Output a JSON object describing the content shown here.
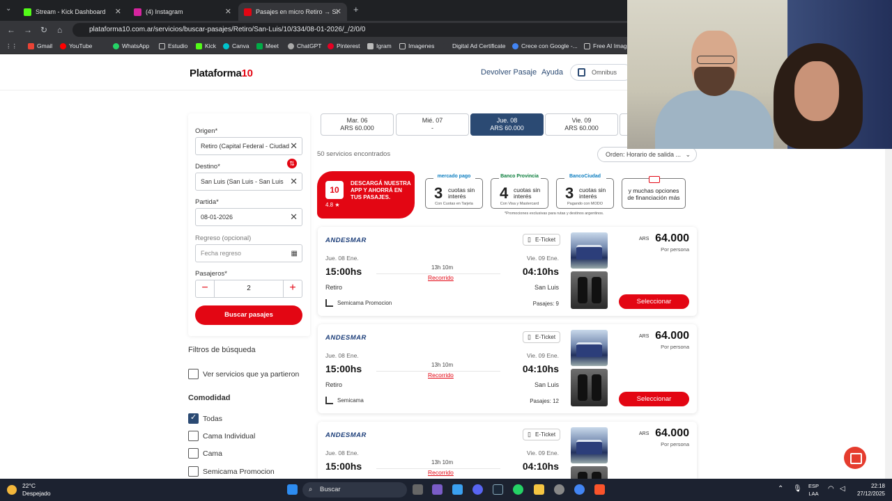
{
  "browser": {
    "tabs": [
      {
        "title": "Stream - Kick Dashboard",
        "color": "#53fc18"
      },
      {
        "title": "(4) Instagram",
        "color": "#d6249f"
      },
      {
        "title": "Pasajes en micro Retiro → San L",
        "color": "#e30613"
      }
    ],
    "url": "plataforma10.com.ar/servicios/buscar-pasajes/Retiro/San-Luis/10/334/08-01-2026/_/2/0/0",
    "bookmarks": [
      "Gmail",
      "YouTube",
      "WhatsApp",
      "Estudio",
      "Kick",
      "Canva",
      "Meet",
      "ChatGPT",
      "Pinterest",
      "Igram",
      "Imagenes",
      "Digital Ad Certificate",
      "Crece con Google -...",
      "Free AI Image"
    ]
  },
  "site": {
    "logo_main": "Plataforma",
    "logo_num": "10",
    "nav": {
      "devolver": "Devolver Pasaje",
      "ayuda": "Ayuda",
      "omnibus": "Omnibus"
    }
  },
  "search": {
    "origen_label": "Origen*",
    "origen_value": "Retiro (Capital Federal - Ciudad",
    "destino_label": "Destino*",
    "destino_value": "San Luis (San Luis - San Luis",
    "partida_label": "Partida*",
    "partida_value": "08-01-2026",
    "regreso_label": "Regreso (opcional)",
    "regreso_placeholder": "Fecha regreso",
    "pasajeros_label": "Pasajeros*",
    "pasajeros_value": "2",
    "buscar": "Buscar pasajes"
  },
  "filters": {
    "title": "Filtros de búsqueda",
    "ver_partidos": "Ver servicios que ya partieron",
    "comodidad_title": "Comodidad",
    "options": [
      {
        "label": "Todas",
        "checked": true
      },
      {
        "label": "Cama Individual",
        "checked": false
      },
      {
        "label": "Cama",
        "checked": false
      },
      {
        "label": "Semicama Promocion",
        "checked": false
      }
    ]
  },
  "dates": [
    {
      "day": "Mar. 06",
      "price": "ARS 60.000",
      "selected": false
    },
    {
      "day": "Mié. 07",
      "price": "-",
      "selected": false
    },
    {
      "day": "Jue. 08",
      "price": "ARS 60.000",
      "selected": true
    },
    {
      "day": "Vie. 09",
      "price": "ARS 60.000",
      "selected": false
    }
  ],
  "results": {
    "count": "50 servicios encontrados",
    "order": "Orden: Horario de salida ..."
  },
  "promo": {
    "app_text": "DESCARGÁ NUESTRA APP Y AHORRÁ EN TUS PASAJES.",
    "app_rating": "4.8 ★",
    "cards": [
      {
        "brand": "mercado pago",
        "num": "3",
        "text": "cuotas sin interés",
        "foot": "Con Cuotas en Tarjeta"
      },
      {
        "brand": "Banco Provincia",
        "num": "4",
        "text": "cuotas sin interés",
        "foot": "Con Visa y Mastercard"
      },
      {
        "brand": "BancoCiudad",
        "num": "3",
        "text": "cuotas sin interés",
        "foot": "Pagando con MODO"
      },
      {
        "brand": "",
        "num": "",
        "text": "y muchas opciones de financiación más",
        "foot": ""
      }
    ],
    "note": "*Promociones exclusivas para rutas y destinos argentinos."
  },
  "trips": [
    {
      "company": "ANDESMAR",
      "eticket": "E-Ticket",
      "ddate": "Jue. 08 Ene.",
      "adate": "Vie. 09 Ene.",
      "dtime": "15:00hs",
      "atime": "04:10hs",
      "duration": "13h 10m",
      "route": "Recorrido",
      "dcity": "Retiro",
      "acity": "San Luis",
      "seat": "Semicama Promocion",
      "pasajes": "Pasajes: 9",
      "currency": "ARS",
      "price": "64.000",
      "per": "Por persona",
      "select": "Seleccionar"
    },
    {
      "company": "ANDESMAR",
      "eticket": "E-Ticket",
      "ddate": "Jue. 08 Ene.",
      "adate": "Vie. 09 Ene.",
      "dtime": "15:00hs",
      "atime": "04:10hs",
      "duration": "13h 10m",
      "route": "Recorrido",
      "dcity": "Retiro",
      "acity": "San Luis",
      "seat": "Semicama",
      "pasajes": "Pasajes: 12",
      "currency": "ARS",
      "price": "64.000",
      "per": "Por persona",
      "select": "Seleccionar"
    },
    {
      "company": "ANDESMAR",
      "eticket": "E-Ticket",
      "ddate": "Jue. 08 Ene.",
      "adate": "Vie. 09 Ene.",
      "dtime": "15:00hs",
      "atime": "04:10hs",
      "duration": "13h 10m",
      "route": "Recorrido",
      "dcity": "",
      "acity": "",
      "seat": "",
      "pasajes": "",
      "currency": "ARS",
      "price": "64.000",
      "per": "Por persona",
      "select": ""
    }
  ],
  "taskbar": {
    "temp": "22°C",
    "weather": "Despejado",
    "search": "Buscar",
    "lang1": "ESP",
    "lang2": "LAA",
    "time": "22:18",
    "date": "27/12/2025"
  }
}
